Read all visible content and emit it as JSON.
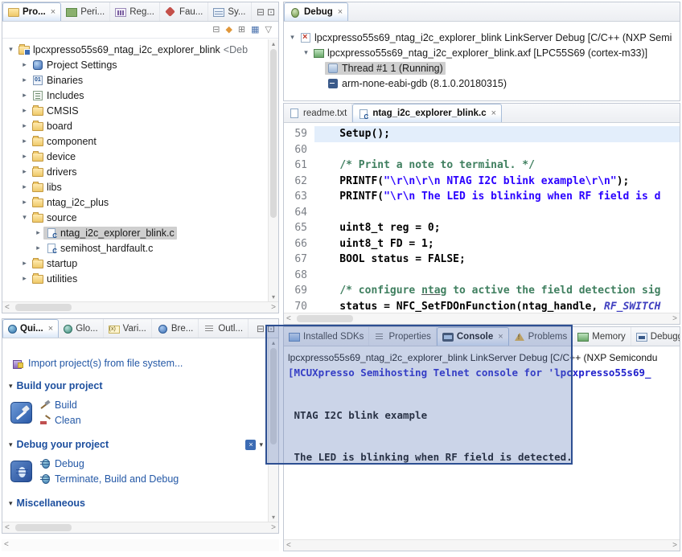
{
  "colors": {
    "annotation_stroke": "#2d4f92",
    "annotation_fill": "rgba(93,122,183,0.32)",
    "selection_gray": "#cfcfcf",
    "link_blue": "#2458a6",
    "console_info_blue": "#2222cc"
  },
  "project_explorer": {
    "tabs": [
      {
        "label": "Pro...",
        "icon": "project-explorer",
        "active": true,
        "closable": true
      },
      {
        "label": "Peri...",
        "icon": "peripherals",
        "active": false
      },
      {
        "label": "Reg...",
        "icon": "registers",
        "active": false
      },
      {
        "label": "Fau...",
        "icon": "faults",
        "active": false
      },
      {
        "label": "Sy...",
        "icon": "symbols",
        "active": false
      }
    ],
    "tree": [
      {
        "label": "lpcxpresso55s69_ntag_i2c_explorer_blink",
        "suffix": " <Deb",
        "level": 0,
        "twist": "open",
        "icon": "project"
      },
      {
        "label": "Project Settings",
        "level": 1,
        "twist": "closed",
        "icon": "settings"
      },
      {
        "label": "Binaries",
        "level": 1,
        "twist": "closed",
        "icon": "binaries"
      },
      {
        "label": "Includes",
        "level": 1,
        "twist": "closed",
        "icon": "includes"
      },
      {
        "label": "CMSIS",
        "level": 1,
        "twist": "closed",
        "icon": "folder"
      },
      {
        "label": "board",
        "level": 1,
        "twist": "closed",
        "icon": "folder"
      },
      {
        "label": "component",
        "level": 1,
        "twist": "closed",
        "icon": "folder"
      },
      {
        "label": "device",
        "level": 1,
        "twist": "closed",
        "icon": "folder"
      },
      {
        "label": "drivers",
        "level": 1,
        "twist": "closed",
        "icon": "folder"
      },
      {
        "label": "libs",
        "level": 1,
        "twist": "closed",
        "icon": "folder"
      },
      {
        "label": "ntag_i2c_plus",
        "level": 1,
        "twist": "closed",
        "icon": "folder"
      },
      {
        "label": "source",
        "level": 1,
        "twist": "open",
        "icon": "folder"
      },
      {
        "label": "ntag_i2c_explorer_blink.c",
        "level": 2,
        "twist": "closed",
        "icon": "cfile",
        "selected": true
      },
      {
        "label": "semihost_hardfault.c",
        "level": 2,
        "twist": "closed",
        "icon": "cfile"
      },
      {
        "label": "startup",
        "level": 1,
        "twist": "closed",
        "icon": "folder"
      },
      {
        "label": "utilities",
        "level": 1,
        "twist": "closed",
        "icon": "folder"
      }
    ]
  },
  "debug_view": {
    "tabs": [
      {
        "label": "Debug",
        "icon": "debug",
        "active": true,
        "closable": true
      }
    ],
    "tree": [
      {
        "label": "lpcxpresso55s69_ntag_i2c_explorer_blink LinkServer Debug [C/C++ (NXP Semi",
        "level": 0,
        "twist": "open",
        "icon": "launch"
      },
      {
        "label": "lpcxpresso55s69_ntag_i2c_explorer_blink.axf [LPC55S69 (cortex-m33)]",
        "level": 1,
        "twist": "open",
        "icon": "program"
      },
      {
        "label": "Thread #1 1 (Running)",
        "level": 2,
        "twist": "none",
        "icon": "thread",
        "selected": true
      },
      {
        "label": "arm-none-eabi-gdb (8.1.0.20180315)",
        "level": 2,
        "twist": "none",
        "icon": "gdb"
      }
    ]
  },
  "editor": {
    "tabs": [
      {
        "label": "readme.txt",
        "icon": "textfile",
        "active": false
      },
      {
        "label": "ntag_i2c_explorer_blink.c",
        "icon": "cfile",
        "active": true,
        "closable": true
      }
    ],
    "lines": [
      {
        "num": 59,
        "hl": true,
        "seg": [
          {
            "t": "    Setup();",
            "c": "p"
          }
        ]
      },
      {
        "num": 60,
        "seg": []
      },
      {
        "num": 61,
        "seg": [
          {
            "t": "    ",
            "c": "p"
          },
          {
            "t": "/* Print a note to terminal. */",
            "c": "cm"
          }
        ]
      },
      {
        "num": 62,
        "seg": [
          {
            "t": "    PRINTF(",
            "c": "p"
          },
          {
            "t": "\"\\r\\n\\r\\n NTAG I2C blink example\\r\\n\"",
            "c": "st"
          },
          {
            "t": ");",
            "c": "p"
          }
        ]
      },
      {
        "num": 63,
        "seg": [
          {
            "t": "    PRINTF(",
            "c": "p"
          },
          {
            "t": "\"\\r\\n The LED is blinking when RF field is d",
            "c": "st"
          }
        ]
      },
      {
        "num": 64,
        "seg": []
      },
      {
        "num": 65,
        "seg": [
          {
            "t": "    uint8_t reg = 0;",
            "c": "p"
          }
        ]
      },
      {
        "num": 66,
        "seg": [
          {
            "t": "    uint8_t FD = 1;",
            "c": "p"
          }
        ]
      },
      {
        "num": 67,
        "seg": [
          {
            "t": "    BOOL status = FALSE;",
            "c": "p"
          }
        ]
      },
      {
        "num": 68,
        "seg": []
      },
      {
        "num": 69,
        "seg": [
          {
            "t": "    ",
            "c": "p"
          },
          {
            "t": "/* configure ",
            "c": "cm"
          },
          {
            "t": "ntag",
            "c": "cmu"
          },
          {
            "t": " to active the field detection sig",
            "c": "cm"
          }
        ]
      },
      {
        "num": 70,
        "seg": [
          {
            "t": "    status = NFC_SetFDOnFunction(ntag_handle, ",
            "c": "p"
          },
          {
            "t": "RF_SWITCH",
            "c": "mac"
          }
        ]
      }
    ]
  },
  "quickstart": {
    "tabs": [
      {
        "label": "Qui...",
        "icon": "quickstart",
        "active": true,
        "closable": true
      },
      {
        "label": "Glo...",
        "icon": "globals",
        "active": false
      },
      {
        "label": "Vari...",
        "icon": "variables",
        "active": false
      },
      {
        "label": "Bre...",
        "icon": "breakpoints",
        "active": false
      },
      {
        "label": "Outl...",
        "icon": "outline",
        "active": false
      }
    ],
    "import_link": "Import project(s) from file system...",
    "sections": [
      {
        "title": "Build your project",
        "big_icon": "build-group",
        "links": [
          {
            "label": "Build",
            "icon": "hammer"
          },
          {
            "label": "Clean",
            "icon": "broom"
          }
        ]
      },
      {
        "title": "Debug your project",
        "big_icon": "debug-group",
        "header_icons": true,
        "links": [
          {
            "label": "Debug",
            "icon": "bug"
          },
          {
            "label": "Terminate, Build and Debug",
            "icon": "bug"
          }
        ]
      },
      {
        "title": "Miscellaneous",
        "big_icon": null,
        "links": []
      }
    ]
  },
  "console": {
    "tabs": [
      {
        "label": "Installed SDKs",
        "icon": "sdk",
        "active": false
      },
      {
        "label": "Properties",
        "icon": "properties",
        "active": false
      },
      {
        "label": "Console",
        "icon": "console",
        "active": true,
        "closable": true
      },
      {
        "label": "Problems",
        "icon": "problems",
        "active": false
      },
      {
        "label": "Memory",
        "icon": "memory",
        "active": false
      },
      {
        "label": "Debugge",
        "icon": "debugger-console",
        "active": false
      }
    ],
    "header_line": "lpcxpresso55s69_ntag_i2c_explorer_blink LinkServer Debug [C/C++ (NXP Semicondu",
    "lines": [
      {
        "text": "[MCUXpresso Semihosting Telnet console for 'lpcxpresso55s69_",
        "style": "info"
      },
      {
        "text": "",
        "style": "out"
      },
      {
        "text": "",
        "style": "out"
      },
      {
        "text": " NTAG I2C blink example",
        "style": "out"
      },
      {
        "text": "",
        "style": "out"
      },
      {
        "text": "",
        "style": "out"
      },
      {
        "text": " The LED is blinking when RF field is detected.",
        "style": "out"
      }
    ]
  }
}
